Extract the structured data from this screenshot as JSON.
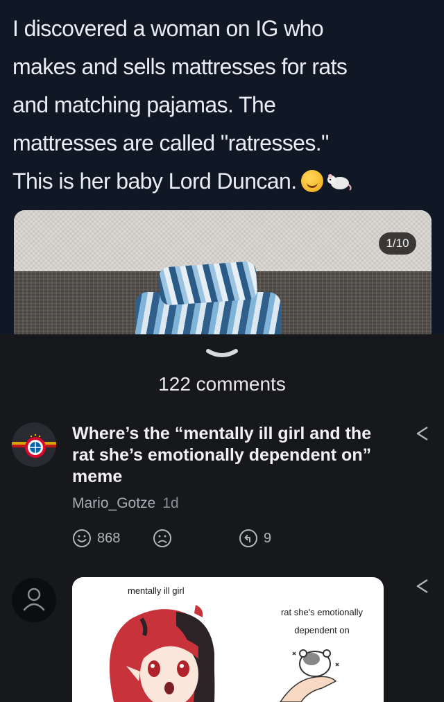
{
  "post": {
    "text": "I discovered a woman on IG who\nmakes and sells mattresses for rats\nand matching pajamas.  The\nmattresses are called \"ratresses.\"\nThis is her baby Lord Duncan.",
    "emojis": [
      "smiling-face-icon",
      "rat-icon"
    ],
    "image_counter": "1/10"
  },
  "comments_header": {
    "count_label": "122 comments"
  },
  "comments": [
    {
      "text": "Where’s the “mentally ill girl and the rat she’s emotionally dependent on” meme",
      "author": "Mario_Gotze",
      "age": "1d",
      "upvotes": "868",
      "replies": "9"
    }
  ],
  "reply_meme": {
    "label_left": "mentally ill girl",
    "label_right": "rat she's emotionally dependent on"
  },
  "colors": {
    "post_bg": "#101826",
    "sheet_bg": "#17181c",
    "text_primary": "#f1f1f3",
    "text_muted": "#a9abb2"
  }
}
